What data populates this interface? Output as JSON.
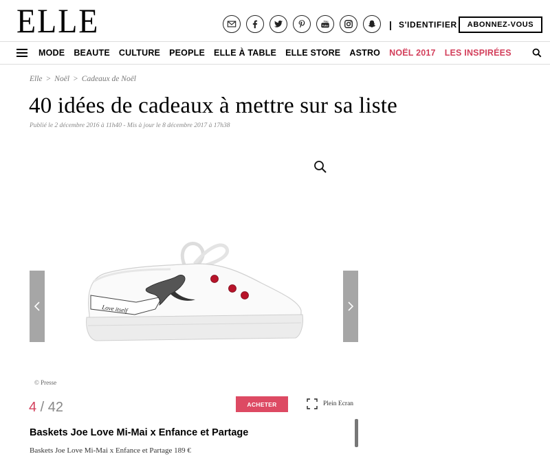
{
  "brand": {
    "logo_text": "ELLE"
  },
  "header": {
    "socials": [
      {
        "icon": "mail-icon"
      },
      {
        "icon": "facebook-icon"
      },
      {
        "icon": "twitter-icon"
      },
      {
        "icon": "pinterest-icon"
      },
      {
        "icon": "youtube-icon"
      },
      {
        "icon": "instagram-icon"
      },
      {
        "icon": "snapchat-icon"
      }
    ],
    "separator": "|",
    "signin_label": "S'IDENTIFIER",
    "subscribe_label": "ABONNEZ-VOUS"
  },
  "nav": {
    "items": [
      "MODE",
      "BEAUTE",
      "CULTURE",
      "PEOPLE",
      "ELLE À TABLE",
      "ELLE STORE",
      "ASTRO",
      "NOËL 2017",
      "LES INSPIRÉES"
    ],
    "highlight_color": "#d3405c"
  },
  "breadcrumb": [
    "Elle",
    ">",
    "Noël",
    ">",
    "Cadeaux de Noël"
  ],
  "article": {
    "title": "40 idées de cadeaux à mettre sur sa liste",
    "published": "Publié le 2 décembre 2016 à 11h40 - Mis à jour le 8 décembre 2017 à 17h38"
  },
  "gallery": {
    "image_credit": "© Presse",
    "current": "4",
    "separator": " / ",
    "total": "42",
    "buy_label": "ACHETER",
    "fullscreen_label": "Plein Ecran",
    "item_title": "Baskets Joe Love Mi-Mai x Enfance et Partage",
    "item_description": "Baskets Joe Love Mi-Mai x Enfance et Partage 189 €",
    "shoe_text": "Love itself",
    "accent_color": "#dd4a63"
  }
}
